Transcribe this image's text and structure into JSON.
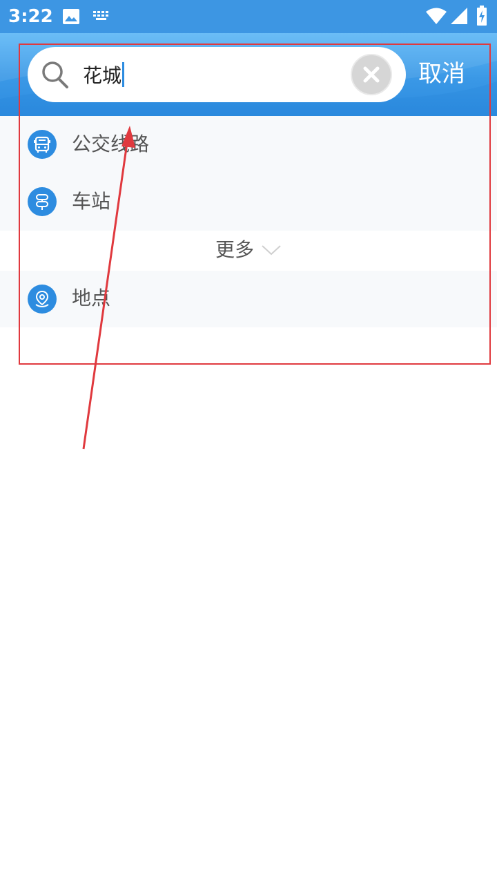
{
  "status_bar": {
    "time": "3:22",
    "icons": [
      "image-icon",
      "keyboard-icon",
      "wifi-icon",
      "cellular-signal-icon",
      "battery-charging-icon"
    ]
  },
  "search": {
    "query": "花城",
    "clear_icon": "close-icon",
    "cancel_label": "取消"
  },
  "results": [
    {
      "icon": "bus-icon",
      "label": "公交线路"
    },
    {
      "icon": "station-icon",
      "label": "车站"
    }
  ],
  "more": {
    "label": "更多",
    "icon": "chevron-down-icon"
  },
  "place": {
    "icon": "location-pin-icon",
    "label": "地点"
  },
  "colors": {
    "header_blue": "#3a98e6",
    "accent_blue": "#2d8ce0",
    "annotation_red": "#e0393e"
  }
}
